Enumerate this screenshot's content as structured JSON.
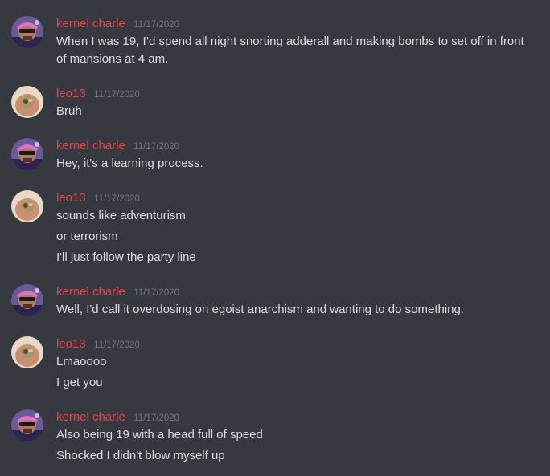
{
  "users": {
    "kernel": {
      "name": "kernel charle",
      "color": "#ed4245",
      "avatar_icon": "avatar-kernel-charle"
    },
    "leo": {
      "name": "leo13",
      "color": "#ed4245",
      "avatar_icon": "avatar-leo13"
    }
  },
  "groups": [
    {
      "user": "kernel charle",
      "timestamp": "11/17/2020",
      "messages": [
        "When I was 19, I’d spend all night snorting adderall and making bombs to set off in front of mansions at 4 am."
      ]
    },
    {
      "user": "leo13",
      "timestamp": "11/17/2020",
      "messages": [
        "Bruh"
      ]
    },
    {
      "user": "kernel charle",
      "timestamp": "11/17/2020",
      "messages": [
        "Hey, it's a learning process."
      ]
    },
    {
      "user": "leo13",
      "timestamp": "11/17/2020",
      "messages": [
        "sounds like adventurism",
        "or terrorism",
        "I'll just follow the party line"
      ]
    },
    {
      "user": "kernel charle",
      "timestamp": "11/17/2020",
      "messages": [
        "Well, I'd call it overdosing on egoist anarchism and wanting to do something."
      ]
    },
    {
      "user": "leo13",
      "timestamp": "11/17/2020",
      "messages": [
        "Lmaoooo",
        "I get you"
      ]
    },
    {
      "user": "kernel charle",
      "timestamp": "11/17/2020",
      "messages": [
        "Also being 19 with a head full of speed",
        "Shocked I didn't blow myself up"
      ]
    }
  ]
}
